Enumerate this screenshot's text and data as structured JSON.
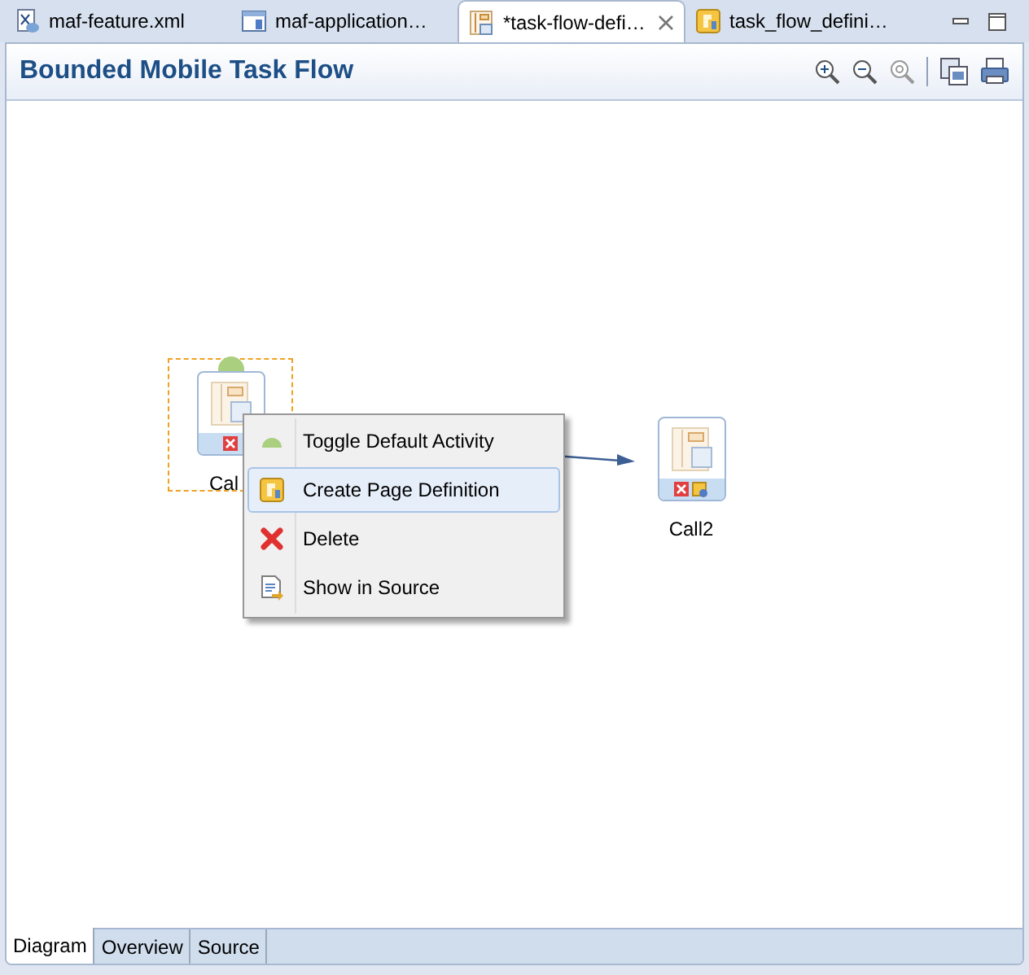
{
  "editor_tabs": [
    {
      "label": "maf-feature.xml",
      "kind": "xml",
      "selected": false,
      "closable": false
    },
    {
      "label": "maf-application…",
      "kind": "window",
      "selected": false,
      "closable": false
    },
    {
      "label": "*task-flow-defi…",
      "kind": "flow",
      "selected": true,
      "closable": true
    },
    {
      "label": "task_flow_defini…",
      "kind": "pagedef",
      "selected": false,
      "closable": false
    }
  ],
  "title": "Bounded Mobile Task Flow",
  "nodes": [
    {
      "label": "Cal",
      "selected": true,
      "default_activity": true,
      "badges": [
        {
          "kind": "error"
        }
      ]
    },
    {
      "label": "Call2",
      "selected": false,
      "default_activity": false,
      "badges": [
        {
          "kind": "error"
        },
        {
          "kind": "pagedef"
        }
      ]
    }
  ],
  "context_menu": [
    {
      "label": "Toggle Default Activity",
      "kind": "default",
      "selected": false
    },
    {
      "label": "Create Page Definition",
      "kind": "pagedef",
      "selected": true
    },
    {
      "label": "Delete",
      "kind": "delete",
      "selected": false
    },
    {
      "label": "Show in Source",
      "kind": "source",
      "selected": false
    }
  ],
  "bottom_tabs": [
    {
      "label": "Diagram",
      "selected": true
    },
    {
      "label": "Overview",
      "selected": false
    },
    {
      "label": "Source",
      "selected": false
    }
  ]
}
